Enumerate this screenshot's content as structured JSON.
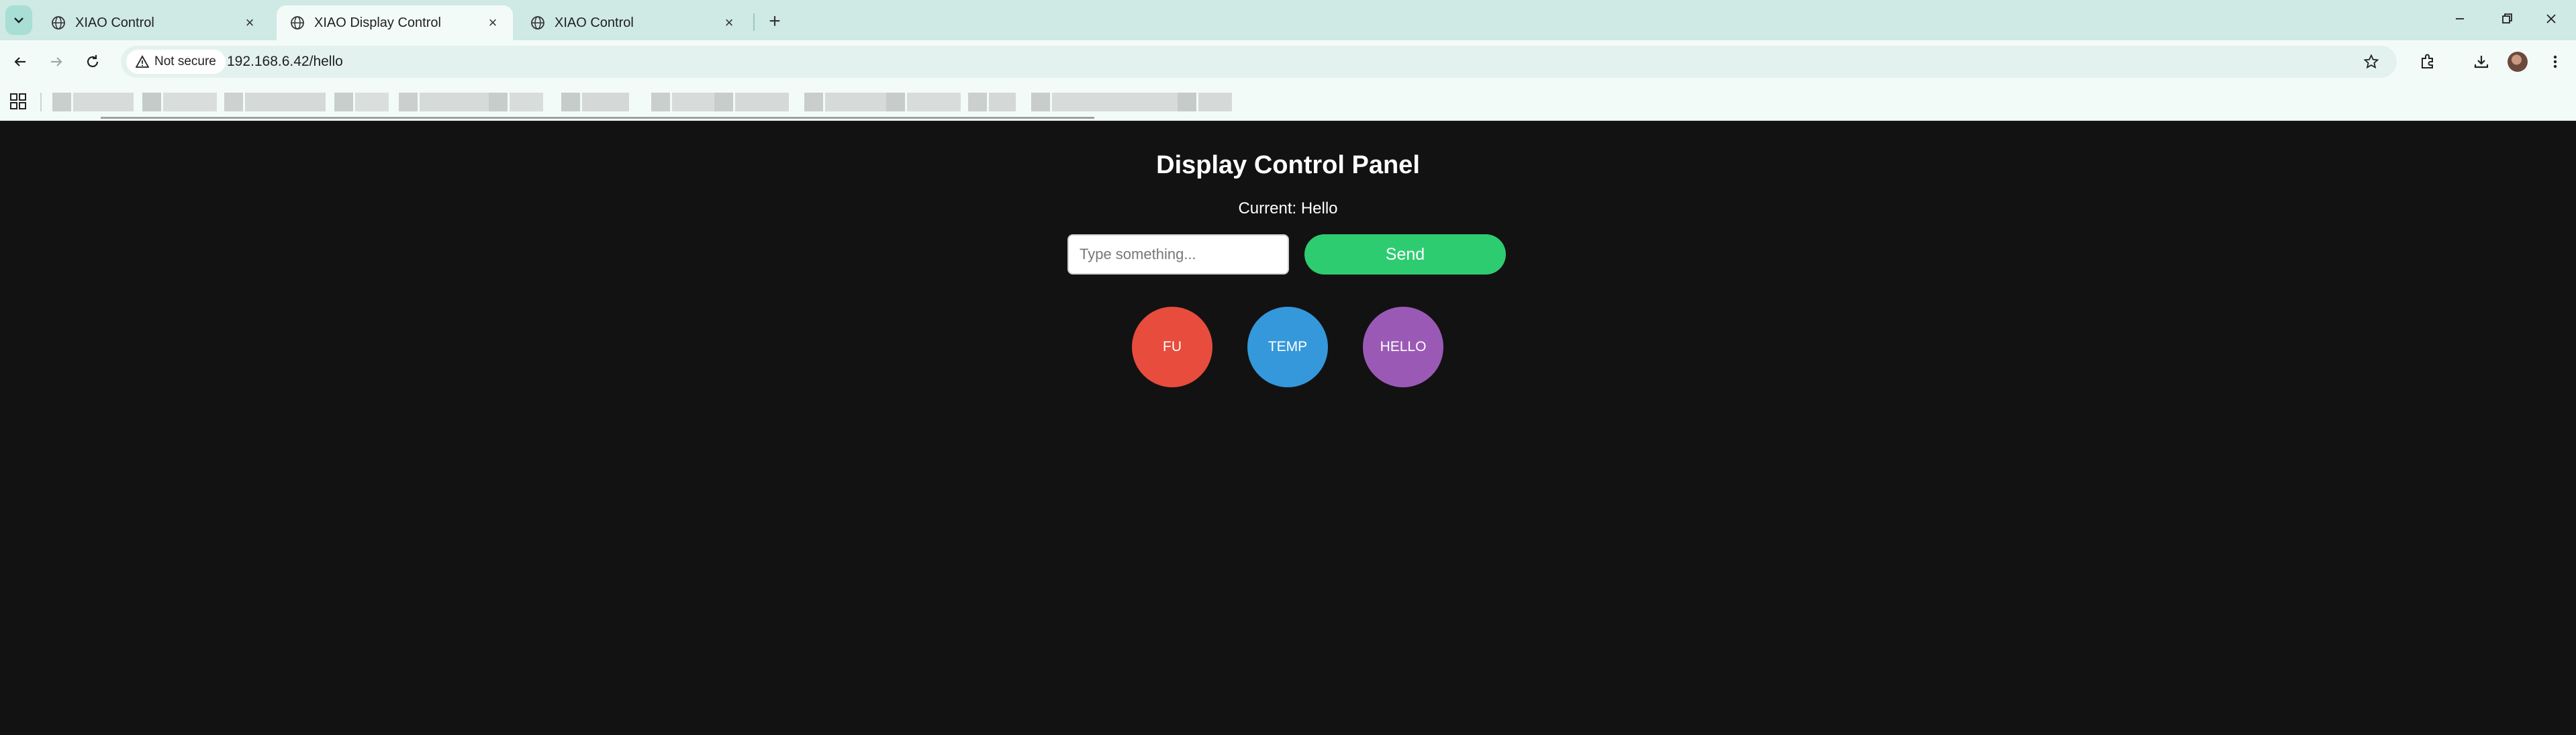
{
  "browser": {
    "tabs": [
      {
        "title": "XIAO Control",
        "active": false
      },
      {
        "title": "XIAO Display Control",
        "active": true
      },
      {
        "title": "XIAO Control",
        "active": false
      }
    ],
    "security_label": "Not secure",
    "url": "192.168.6.42/hello"
  },
  "page": {
    "heading": "Display Control Panel",
    "current_text": "Current: Hello",
    "input": {
      "placeholder": "Type something...",
      "value": ""
    },
    "send_label": "Send",
    "quick_buttons": [
      {
        "label": "FU",
        "color": "#e74c3c"
      },
      {
        "label": "TEMP",
        "color": "#3498db"
      },
      {
        "label": "HELLO",
        "color": "#9b59b6"
      }
    ]
  },
  "colors": {
    "page_bg": "#121212",
    "send_green": "#2ecc71",
    "chrome_tabstrip": "#cfe9e4"
  }
}
